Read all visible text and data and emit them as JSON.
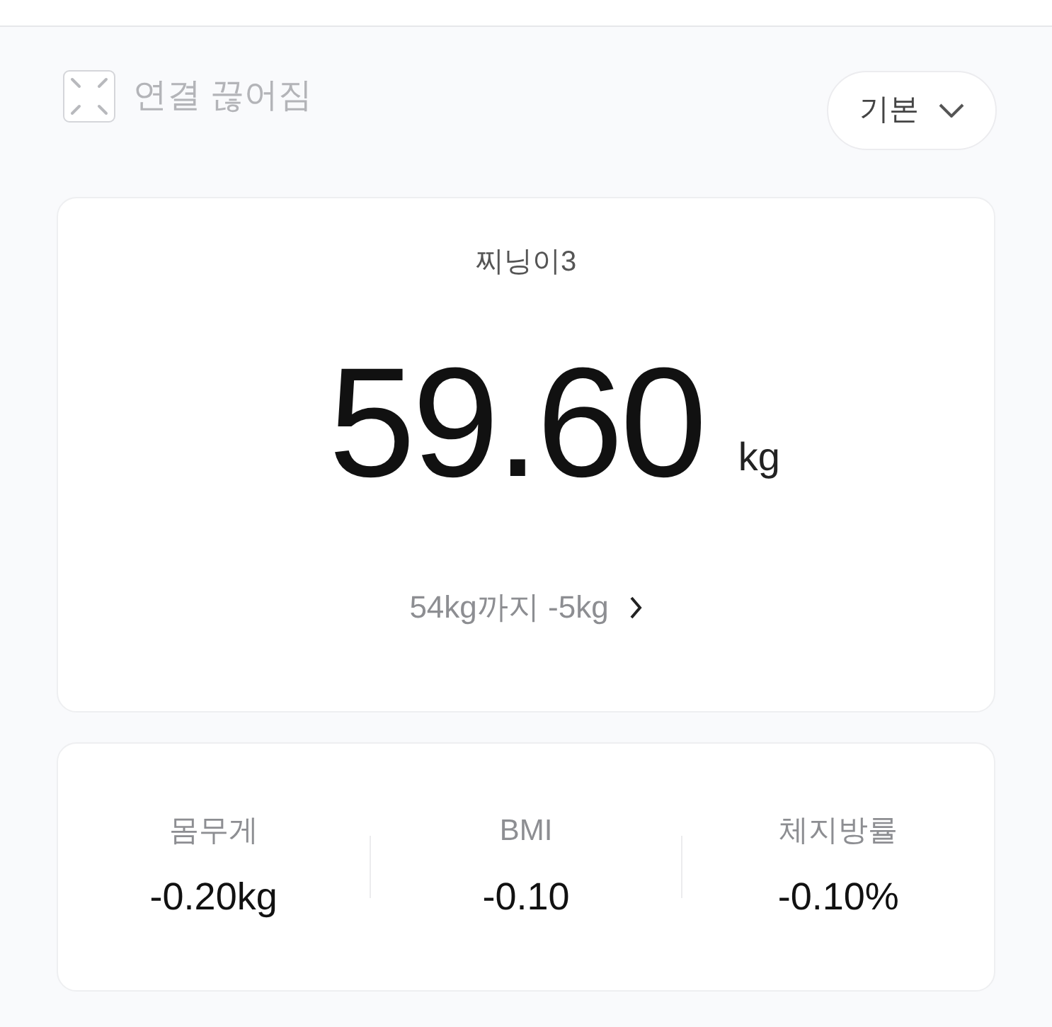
{
  "status": {
    "label": "연결 끊어짐"
  },
  "mode_dropdown": {
    "label": "기본"
  },
  "weight_card": {
    "name": "찌닝이3",
    "value": "59.60",
    "unit": "kg",
    "goal": "54kg까지 -5kg"
  },
  "changes": [
    {
      "label": "몸무게",
      "value": "-0.20kg"
    },
    {
      "label": "BMI",
      "value": "-0.10"
    },
    {
      "label": "체지방률",
      "value": "-0.10%"
    }
  ]
}
